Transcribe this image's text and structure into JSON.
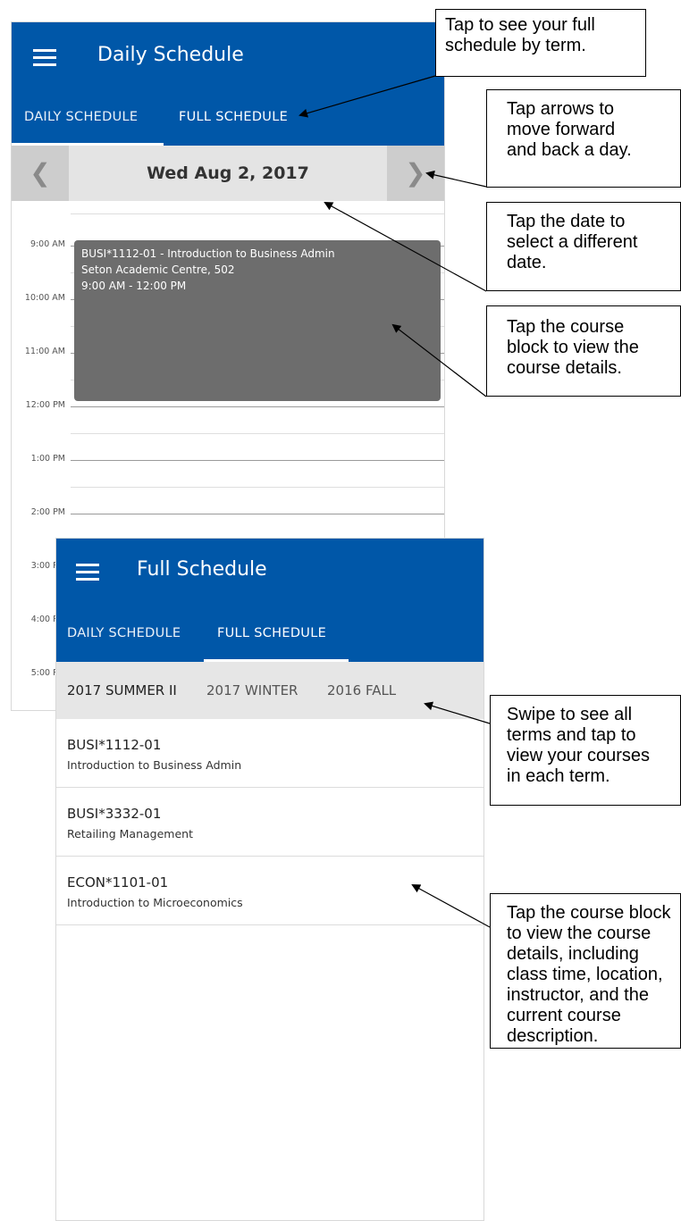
{
  "daily": {
    "title": "Daily Schedule",
    "tabs": [
      "DAILY SCHEDULE",
      "FULL SCHEDULE"
    ],
    "date": "Wed Aug 2, 2017",
    "prev_arrow": "❮",
    "next_arrow": "❯",
    "hours": [
      "9:00 AM",
      "10:00 AM",
      "11:00 AM",
      "12:00 PM",
      "1:00 PM",
      "2:00 PM",
      "3:00 PM",
      "4:00 PM",
      "5:00 PM"
    ],
    "course_block": {
      "title": "BUSI*1112-01 - Introduction to Business Admin",
      "location": "Seton Academic Centre, 502",
      "time": "9:00 AM - 12:00 PM"
    }
  },
  "full": {
    "title": "Full Schedule",
    "tabs": [
      "DAILY SCHEDULE",
      "FULL SCHEDULE"
    ],
    "terms": [
      "2017 SUMMER II",
      "2017 WINTER",
      "2016 FALL"
    ],
    "courses": [
      {
        "code": "BUSI*1112-01",
        "name": "Introduction to Business Admin"
      },
      {
        "code": "BUSI*3332-01",
        "name": "Retailing Management"
      },
      {
        "code": "ECON*1101-01",
        "name": "Introduction to Microeconomics"
      }
    ]
  },
  "callouts": [
    "Tap to see your full\nschedule by term.",
    "Tap arrows to\nmove forward\nand back a day.",
    "Tap the date to\nselect a different\ndate.",
    "Tap the course\nblock to view the\ncourse details.",
    "Swipe to see all\nterms and tap to\nview your courses\nin each term.",
    "Tap the course block\nto view the course\ndetails, including\nclass time, location,\ninstructor, and the\ncurrent course\ndescription."
  ]
}
